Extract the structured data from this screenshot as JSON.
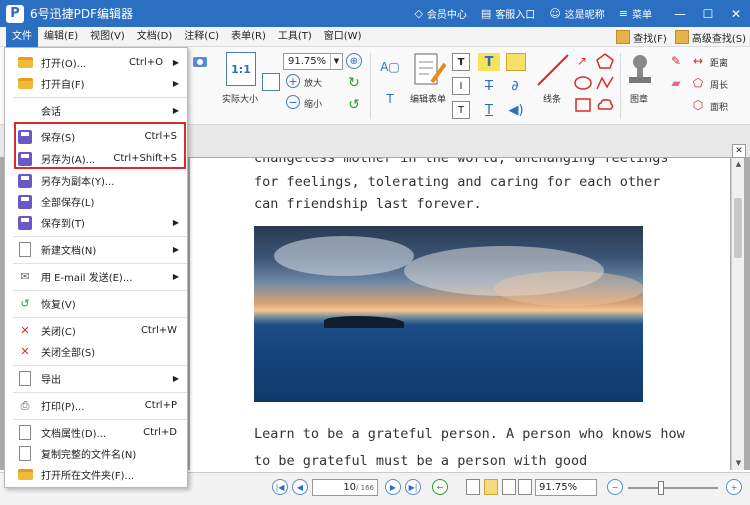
{
  "titlebar": {
    "logo_letter": "P",
    "title": "6号迅捷PDF编辑器",
    "member": "会员中心",
    "service": "客服入口",
    "nickname": "这是昵称",
    "menu": "菜单"
  },
  "menubar": {
    "items": [
      "文件",
      "编辑(E)",
      "视图(V)",
      "文档(D)",
      "注释(C)",
      "表单(R)",
      "工具(T)",
      "窗口(W)"
    ],
    "find": "查找(F)",
    "advanced_find": "高级查找(S)"
  },
  "ribbon": {
    "zoom": "91.75%",
    "actual_size": "实际大小",
    "zoom_in": "放大",
    "zoom_out": "缩小",
    "edit_form": "编辑表单",
    "lines": "线条",
    "stamp": "图章",
    "distance": "距离",
    "perimeter": "周长",
    "area": "面积",
    "ratio_label": "1:1"
  },
  "filemenu": {
    "items": [
      {
        "label": "打开(O)...",
        "shortcut": "Ctrl+O",
        "arrow": true,
        "icon": "folder-open-icon"
      },
      {
        "label": "打开自(F)",
        "shortcut": "",
        "arrow": true,
        "icon": "folder-icon"
      },
      {
        "label": "会话",
        "shortcut": "",
        "arrow": true,
        "icon": ""
      },
      {
        "label": "保存(S)",
        "shortcut": "Ctrl+S",
        "arrow": false,
        "icon": "save-icon"
      },
      {
        "label": "另存为(A)...",
        "shortcut": "Ctrl+Shift+S",
        "arrow": false,
        "icon": "save-as-icon"
      },
      {
        "label": "另存为副本(Y)...",
        "shortcut": "",
        "arrow": false,
        "icon": "save-copy-icon"
      },
      {
        "label": "全部保存(L)",
        "shortcut": "",
        "arrow": false,
        "icon": "save-all-icon"
      },
      {
        "label": "保存到(T)",
        "shortcut": "",
        "arrow": true,
        "icon": "save-to-icon"
      },
      {
        "label": "新建文档(N)",
        "shortcut": "",
        "arrow": true,
        "icon": "new-document-icon"
      },
      {
        "label": "用 E-mail 发送(E)...",
        "shortcut": "",
        "arrow": true,
        "icon": "email-icon"
      },
      {
        "label": "恢复(V)",
        "shortcut": "",
        "arrow": false,
        "icon": "restore-icon"
      },
      {
        "label": "关闭(C)",
        "shortcut": "Ctrl+W",
        "arrow": false,
        "icon": "close-document-icon"
      },
      {
        "label": "关闭全部(S)",
        "shortcut": "",
        "arrow": false,
        "icon": "close-all-icon"
      },
      {
        "label": "导出",
        "shortcut": "",
        "arrow": true,
        "icon": "export-icon"
      },
      {
        "label": "打印(P)...",
        "shortcut": "Ctrl+P",
        "arrow": false,
        "icon": "print-icon"
      },
      {
        "label": "文档属性(D)...",
        "shortcut": "Ctrl+D",
        "arrow": false,
        "icon": "properties-icon"
      },
      {
        "label": "复制完整的文件名(N)",
        "shortcut": "",
        "arrow": false,
        "icon": "copy-filename-icon"
      },
      {
        "label": "打开所在文件夹(F)...",
        "shortcut": "",
        "arrow": false,
        "icon": "open-folder-icon"
      }
    ]
  },
  "document": {
    "line_partial": "changeless mother in the world, unchanging feelings",
    "line1": "for feelings, tolerating and caring for each other",
    "line2": "can friendship last forever.",
    "line3": "Learn to be a grateful person. A person who knows how",
    "line4": "to be grateful must be a person with good"
  },
  "statusbar": {
    "current_page": "10",
    "total_pages": "/ 166",
    "zoom": "91.75%"
  },
  "colors": {
    "titlebar": "#2b6fc2",
    "highlight": "#d92b2b"
  }
}
